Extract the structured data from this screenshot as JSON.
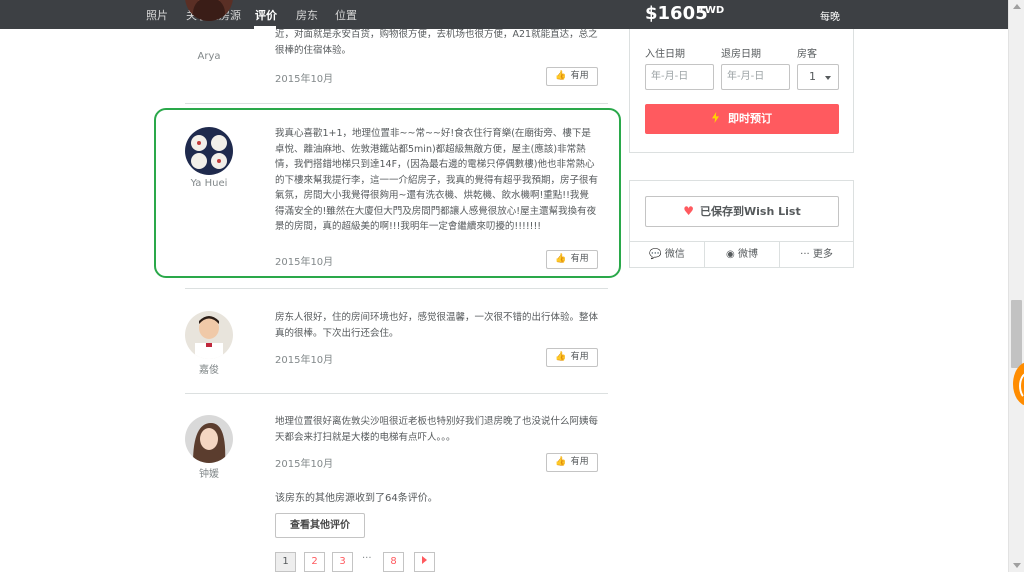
{
  "nav": {
    "items": [
      {
        "label": "照片"
      },
      {
        "label": "关于此房源"
      },
      {
        "label": "评价",
        "active": true
      },
      {
        "label": "房东"
      },
      {
        "label": "位置"
      }
    ]
  },
  "price": {
    "amount": "$1605",
    "currency": "TWD",
    "per": "每晚"
  },
  "booking": {
    "checkin_label": "入住日期",
    "checkout_label": "退房日期",
    "guests_label": "房客",
    "checkin_placeholder": "年-月-日",
    "checkout_placeholder": "年-月-日",
    "guests_value": "1",
    "book_label": "即时预订"
  },
  "wishlist": {
    "label": "已保存到Wish List",
    "share": [
      {
        "label": "微信",
        "icon": "wechat-icon"
      },
      {
        "label": "微博",
        "icon": "weibo-icon"
      },
      {
        "label": "··· 更多",
        "icon": "more-icon"
      }
    ]
  },
  "reviews": [
    {
      "name": "Arya",
      "text": "近，对面就是永安百货，购物很方便，去机场也很方便，A21就能直达，总之很棒的住宿体验。",
      "date": "2015年10月",
      "helpful_label": "有用"
    },
    {
      "name": "Ya Huei",
      "text": "我真心喜歡1+1，地理位置非~~常~~好!食衣住行育樂(在廟街旁、樓下是卓悅、離油麻地、佐敦港鐵站都5min)都超級無敵方便，屋主(應該)非常熱情，我們搭錯地梯只到達14F，(因為最右邊的電梯只停偶數樓)他也非常熱心的下樓來幫我提行李，這一一介紹房子，我真的覺得有超乎我預期，房子很有氣氛，房間大小我覺得很夠用~還有洗衣機、烘乾機、飲水機啊!重點!!我覺得滿安全的!雖然在大廈但大門及房間門都讓人感覺很放心!屋主還幫我換有夜景的房間，真的超級美的啊!!!我明年一定會繼續來叨擾的!!!!!!!",
      "date": "2015年10月",
      "helpful_label": "有用"
    },
    {
      "name": "嘉俊",
      "text": "房东人很好，住的房间环境也好，感觉很温馨，一次很不错的出行体验。整体真的很棒。下次出行还会住。",
      "date": "2015年10月",
      "helpful_label": "有用"
    },
    {
      "name": "钟媛",
      "text": "地理位置很好离佐敦尖沙咀很近老板也特别好我们退房晚了也没说什么阿姨每天都会来打扫就是大楼的电梯有点吓人。。。",
      "date": "2015年10月",
      "helpful_label": "有用"
    }
  ],
  "other_reviews": {
    "text": "该房东的其他房源收到了64条评价。",
    "button": "查看其他评价"
  },
  "pagination": {
    "pages": [
      "1",
      "2",
      "3",
      "8"
    ],
    "ellipsis": "···",
    "current": "1"
  },
  "colors": {
    "accent": "#ff5a5f",
    "nav_bg": "#3d4044",
    "highlight": "#2aa84a"
  }
}
